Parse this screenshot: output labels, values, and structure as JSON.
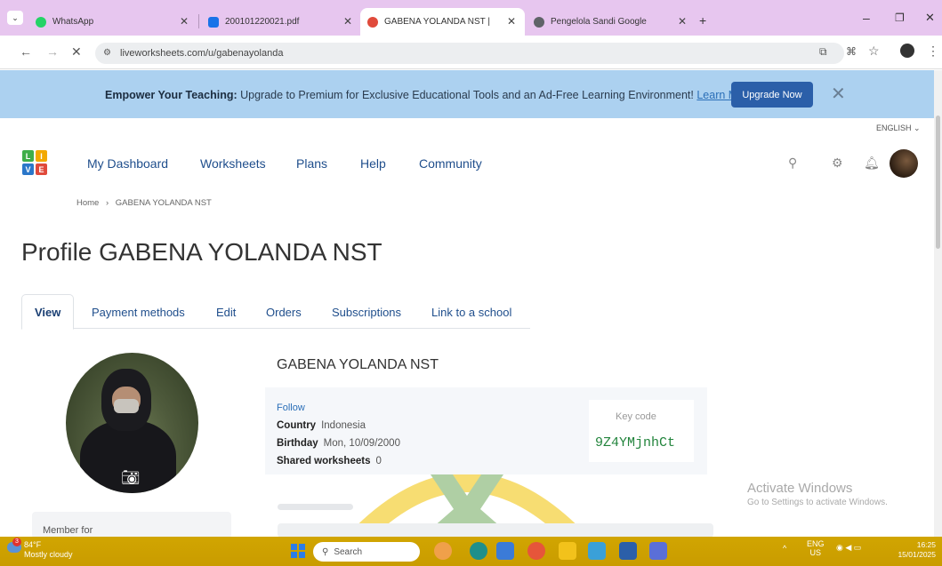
{
  "browser": {
    "tabs": [
      {
        "label": "WhatsApp",
        "icon": "whatsapp-icon",
        "color": "#25d366"
      },
      {
        "label": "200101220021.pdf",
        "icon": "pdf-icon",
        "color": "#1a73e8"
      },
      {
        "label": "GABENA YOLANDA NST | LiveW",
        "icon": "liveworksheets-icon",
        "color": "#e04a3b"
      },
      {
        "label": "Pengelola Sandi Google",
        "icon": "key-icon",
        "color": "#5f6368"
      }
    ],
    "new_tab": "+",
    "url": "liveworksheets.com/u/gabenayolanda"
  },
  "promo": {
    "bold": "Empower Your Teaching:",
    "text": " Upgrade to Premium for Exclusive Educational Tools and an Ad-Free Learning Environment! ",
    "link": "Learn More",
    "button": "Upgrade Now",
    "close": "✕"
  },
  "header": {
    "language": "ENGLISH ⌄",
    "logo_letters": [
      "L",
      "I",
      "V",
      "E"
    ],
    "menu": [
      "My Dashboard",
      "Worksheets",
      "Plans",
      "Help",
      "Community"
    ]
  },
  "breadcrumb": {
    "home": "Home",
    "sep": "›",
    "current": "GABENA YOLANDA NST"
  },
  "page_title": "Profile GABENA YOLANDA NST",
  "profile_tabs": [
    "View",
    "Payment methods",
    "Edit",
    "Orders",
    "Subscriptions",
    "Link to a school"
  ],
  "profile": {
    "name": "GABENA YOLANDA NST",
    "follow": "Follow",
    "country_label": "Country",
    "country": "Indonesia",
    "birthday_label": "Birthday",
    "birthday": "Mon, 10/09/2000",
    "shared_label": "Shared worksheets",
    "shared": "0",
    "key_label": "Key code",
    "key_code": "9Z4YMjnhCt",
    "member_for": "Member for"
  },
  "activate": {
    "title": "Activate Windows",
    "sub": "Go to Settings to activate Windows."
  },
  "taskbar": {
    "temp": "84°F",
    "weather": "Mostly cloudy",
    "badge": "3",
    "search": "Search",
    "lang1": "ENG",
    "lang2": "US",
    "time": "16:25",
    "date": "15/01/2025"
  }
}
